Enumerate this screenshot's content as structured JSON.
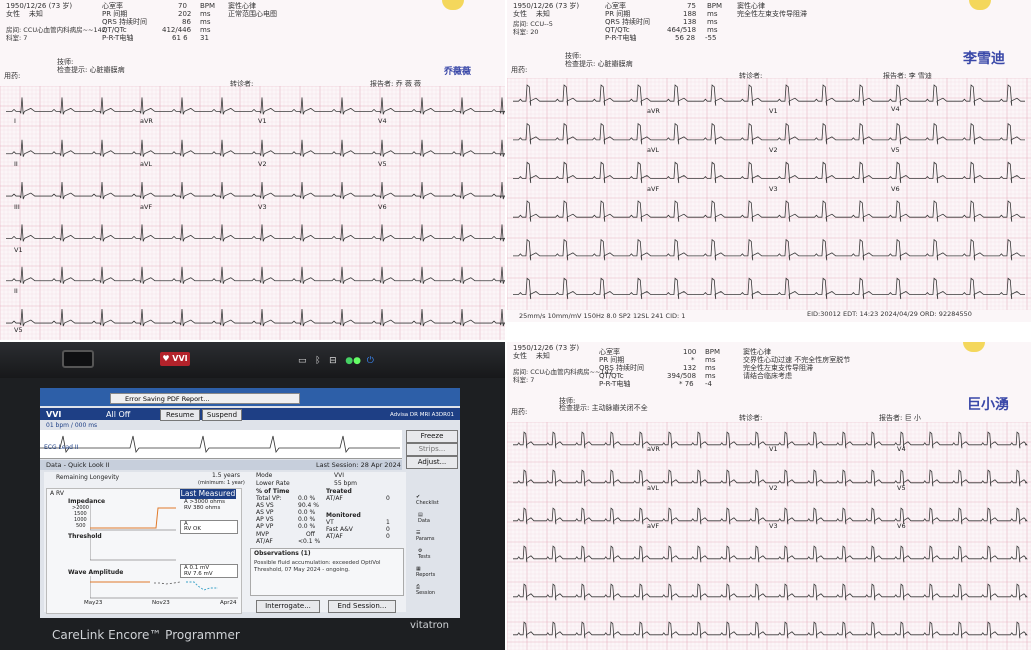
{
  "panels": {
    "tl": {
      "patient": {
        "dob": "1950/12/26 (73 岁)",
        "sex": "女性",
        "age_unknown": "未知",
        "ward": "房间: CCU心血管内科病房~~142",
        "case": "科室: 7"
      },
      "measurements": [
        [
          "心室率",
          "70",
          "BPM"
        ],
        [
          "PR 间期",
          "202",
          "ms"
        ],
        [
          "QRS 持续时间",
          "86",
          "ms"
        ],
        [
          "QT/QTc",
          "412/446",
          "ms"
        ],
        [
          "P-R-T电轴",
          "61  6",
          "31"
        ]
      ],
      "diagnosis": [
        "窦性心律",
        "正常范围心电图"
      ],
      "tech": "技师:",
      "hint": "检查提示: 心脏瓣膜病",
      "meds": "用药:",
      "reviewer": "转诊者:",
      "reporter": "报告者:",
      "reporter_name": "乔 薇 薇",
      "signature": "乔薇薇",
      "leads": [
        "I",
        "aVR",
        "V1",
        "V4",
        "II",
        "aVL",
        "V2",
        "V5",
        "III",
        "aVF",
        "V3",
        "V6",
        "V1",
        "II",
        "V5"
      ]
    },
    "tr": {
      "patient": {
        "dob": "1950/12/26 (73 岁)",
        "sex": "女性",
        "age_unknown": "未知",
        "ward": "房间: CCU--5",
        "case": "科室: 20"
      },
      "measurements": [
        [
          "心室率",
          "75",
          "BPM"
        ],
        [
          "PR 间期",
          "188",
          "ms"
        ],
        [
          "QRS 持续时间",
          "138",
          "ms"
        ],
        [
          "QT/QTc",
          "464/518",
          "ms"
        ],
        [
          "P-R-T电轴",
          "56  28",
          "-55"
        ]
      ],
      "diagnosis": [
        "窦性心律",
        "完全性左束支传导阻滞"
      ],
      "tech": "技师:",
      "hint": "检查提示: 心脏瓣膜病",
      "meds": "用药:",
      "reviewer": "转诊者:",
      "reporter": "报告者:",
      "reporter_name": "李 雪迪",
      "signature": "李雪迪",
      "leads": [
        "aVR",
        "V1",
        "V4",
        "aVL",
        "V2",
        "V5",
        "aVF",
        "V3",
        "V6"
      ],
      "footer": "25mm/s      10mm/mV      150Hz      8.0 SP2      12SL 241      CID: 1",
      "footer2": "EID:30012 EDT: 14:23 2024/04/29 ORD: 92284550"
    },
    "br": {
      "patient": {
        "dob": "1950/12/26 (73 岁)",
        "sex": "女性",
        "age_unknown": "未知",
        "ward": "房间: CCU心血管内科病房~~142",
        "case": "科室: 7"
      },
      "measurements": [
        [
          "心室率",
          "100",
          "BPM"
        ],
        [
          "PR 间期",
          "*",
          "ms"
        ],
        [
          "QRS 持续时间",
          "132",
          "ms"
        ],
        [
          "QT/QTc",
          "394/508",
          "ms"
        ],
        [
          "P-R-T电轴",
          "* 76",
          "-4"
        ]
      ],
      "diagnosis": [
        "窦性心律",
        "交界性心动过速  不完全性房室脱节",
        "完全性左束支传导阻滞",
        "请结合临床考虑"
      ],
      "tech": "技师:",
      "hint": "检查提示: 主动脉瓣关闭不全",
      "meds": "用药:",
      "reviewer": "转诊者:",
      "reporter": "报告者:",
      "reporter_name": "巨 小",
      "signature": "巨小湧",
      "leads": [
        "aVR",
        "V1",
        "V4",
        "aVL",
        "V2",
        "V5",
        "aVF",
        "V3",
        "V6"
      ]
    },
    "device": {
      "mode_badge": "VVI",
      "title": "Error Saving PDF Report...",
      "mode": "VVI",
      "all_off": "All Off",
      "resume": "Resume",
      "suspend": "Suspend",
      "speed": "01 bpm / 000 ms",
      "model": "Advisa DR MRI A3DR01",
      "ecg_lead": "ECG Lead II",
      "freeze": "Freeze",
      "strips": "Strips...",
      "adjust": "Adjust...",
      "data_tab": "Data - Quick Look II",
      "last_session": "Last Session: 28 Apr 2024",
      "remaining": "Remaining Longevity",
      "longevity": "1.5 years",
      "longevity_range": "(minimum: 1 year)",
      "mode_label": "Mode",
      "mode_value": "VVI",
      "lower_rate_label": "Lower Rate",
      "lower_rate_value": "55 bpm",
      "lead_a_rv": "A  RV",
      "last_measured": "Last Measured",
      "impedance_label": "Impedance",
      "imp_a": "A  >3000 ohms",
      "imp_rv": "RV  380 ohms",
      "imp_ticks": [
        ">2000",
        "1500",
        "1000",
        "500"
      ],
      "threshold_label": "Threshold",
      "thr_a": "A",
      "thr_rv": "RV  OK",
      "wave_label": "Wave Amplitude",
      "wave_a": "A   0.1 mV",
      "wave_rv": "RV  7.6 mV",
      "xaxis": [
        "May23",
        "Nov23",
        "Apr24"
      ],
      "pct_time": "% of Time",
      "pct_rows": [
        [
          "Total VP:",
          "0.0 %"
        ],
        [
          "AS VS",
          "90.4 %"
        ],
        [
          "AS VP",
          "0.0 %"
        ],
        [
          "AP VS",
          "0.0 %"
        ],
        [
          "AP VP",
          "0.0 %"
        ],
        [
          "MVP",
          "Off"
        ],
        [
          "AT/AF",
          "<0.1 %"
        ]
      ],
      "treated": "Treated",
      "treated_row": [
        "AT/AF",
        "0"
      ],
      "monitored": "Monitored",
      "mon_rows": [
        [
          "VT",
          "1"
        ],
        [
          "Fast A&V",
          "0"
        ],
        [
          "AT/AF",
          "0"
        ]
      ],
      "observations": "Observations (1)",
      "obs_text": "Possible fluid accumulation: exceeded OptiVol Threshold, 07 May 2024 - ongoing.",
      "side": [
        "Checklist",
        "Data",
        "Params",
        "Tests",
        "Reports",
        "Session"
      ],
      "interrogate": "Interrogate...",
      "end_session": "End Session...",
      "carelink": "CareLink Encore™ Programmer",
      "vitatron": "vitatron"
    }
  },
  "colors": {
    "grid_minor": "#f1d7df",
    "grid_major": "#e7b3c2",
    "trace": "#3a3a3a",
    "sig": "#3a48a8",
    "device_blue": "#1e3f85"
  }
}
